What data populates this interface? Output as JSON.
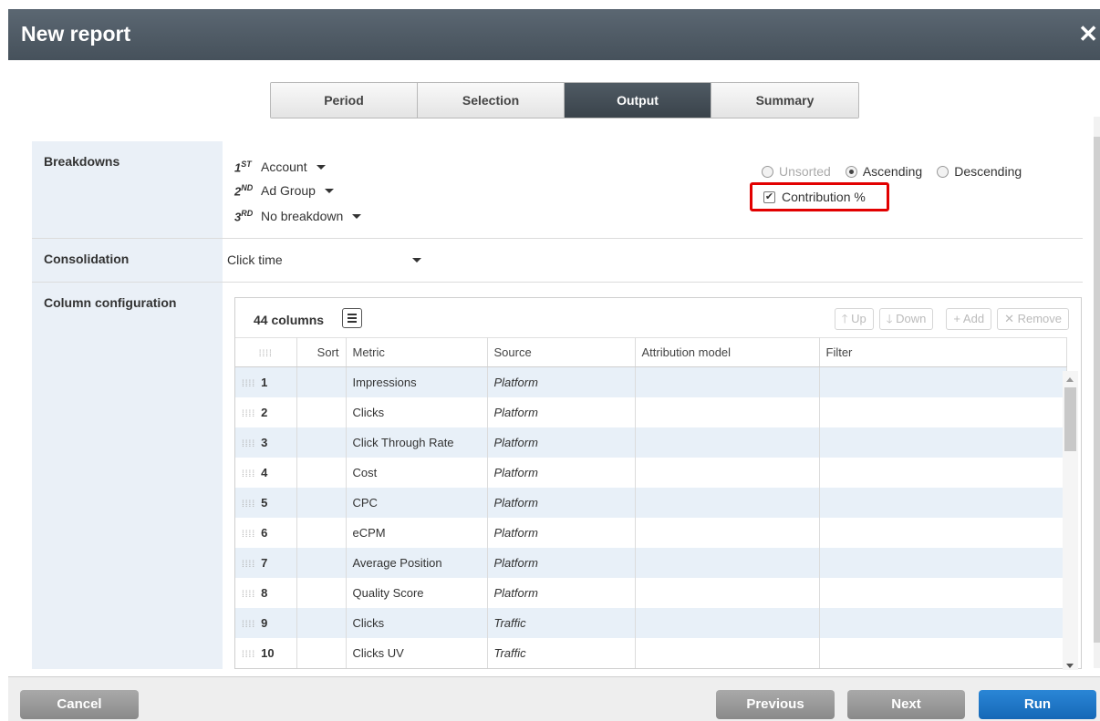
{
  "dialog": {
    "title": "New report"
  },
  "tabs": [
    "Period",
    "Selection",
    "Output",
    "Summary"
  ],
  "active_tab": "Output",
  "breakdowns": {
    "label": "Breakdowns",
    "rows": [
      {
        "ordinal": "1",
        "suffix": "ST",
        "value": "Account"
      },
      {
        "ordinal": "2",
        "suffix": "ND",
        "value": "Ad Group"
      },
      {
        "ordinal": "3",
        "suffix": "RD",
        "value": "No breakdown"
      }
    ],
    "sort_options": [
      "Unsorted",
      "Ascending",
      "Descending"
    ],
    "selected_sort": "Ascending",
    "contribution_label": "Contribution %",
    "contribution_checked": true
  },
  "consolidation": {
    "label": "Consolidation",
    "value": "Click time"
  },
  "columns": {
    "label": "Column configuration",
    "count": "44 columns",
    "actions": {
      "up": "Up",
      "down": "Down",
      "add": "Add",
      "remove": "Remove"
    },
    "headers": {
      "sort": "Sort",
      "metric": "Metric",
      "source": "Source",
      "attribution": "Attribution model",
      "filter": "Filter"
    },
    "rows": [
      {
        "n": "1",
        "metric": "Impressions",
        "source": "Platform"
      },
      {
        "n": "2",
        "metric": "Clicks",
        "source": "Platform"
      },
      {
        "n": "3",
        "metric": "Click Through Rate",
        "source": "Platform"
      },
      {
        "n": "4",
        "metric": "Cost",
        "source": "Platform"
      },
      {
        "n": "5",
        "metric": "CPC",
        "source": "Platform"
      },
      {
        "n": "6",
        "metric": "eCPM",
        "source": "Platform"
      },
      {
        "n": "7",
        "metric": "Average Position",
        "source": "Platform"
      },
      {
        "n": "8",
        "metric": "Quality Score",
        "source": "Platform"
      },
      {
        "n": "9",
        "metric": "Clicks",
        "source": "Traffic"
      },
      {
        "n": "10",
        "metric": "Clicks UV",
        "source": "Traffic"
      }
    ]
  },
  "footer": {
    "cancel": "Cancel",
    "previous": "Previous",
    "next": "Next",
    "run": "Run"
  }
}
